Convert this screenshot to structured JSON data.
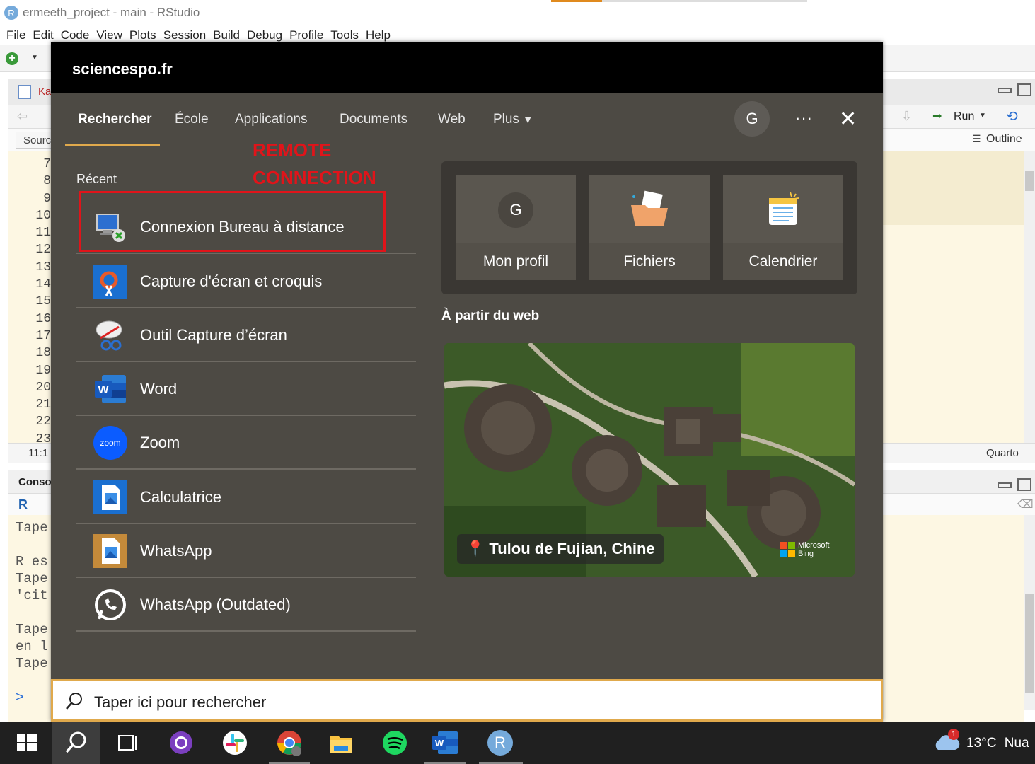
{
  "rstudio": {
    "title": "ermeeth_project - main - RStudio",
    "menu": [
      "File",
      "Edit",
      "Code",
      "View",
      "Plots",
      "Session",
      "Build",
      "Debug",
      "Profile",
      "Tools",
      "Help"
    ],
    "editor_tab": "Ka",
    "source_tab": "Sourc",
    "run_label": "Run",
    "outline_label": "Outline",
    "line_numbers": [
      "7",
      "8",
      "9",
      "10",
      "11",
      "12",
      "13",
      "14",
      "15",
      "16",
      "17",
      "18",
      "19",
      "20",
      "21",
      "22",
      "23"
    ],
    "status_position": "11:1",
    "status_lang": "Quarto",
    "console_tab": "Conso",
    "console_lines": [
      "Tape",
      "",
      "R es",
      "Tape",
      "'cit",
      "",
      "Tape",
      "en l",
      "Tape"
    ],
    "prompt": ">"
  },
  "start_menu": {
    "org": "sciencespo.fr",
    "tabs": [
      "Rechercher",
      "École",
      "Applications",
      "Documents",
      "Web",
      "Plus"
    ],
    "avatar_letter": "G",
    "annotation": [
      "REMOTE",
      "CONNECTION"
    ],
    "recent_label": "Récent",
    "recent_apps": [
      {
        "label": "Connexion Bureau à distance",
        "icon": "remote-desktop-icon"
      },
      {
        "label": "Capture d'écran et croquis",
        "icon": "snip-sketch-icon"
      },
      {
        "label": "Outil Capture d’écran",
        "icon": "snipping-tool-icon"
      },
      {
        "label": "Word",
        "icon": "word-icon"
      },
      {
        "label": "Zoom",
        "icon": "zoom-icon"
      },
      {
        "label": "Calculatrice",
        "icon": "calculator-icon"
      },
      {
        "label": "WhatsApp",
        "icon": "whatsapp-icon"
      },
      {
        "label": "WhatsApp (Outdated)",
        "icon": "whatsapp-outdated-icon"
      }
    ],
    "quick_links": [
      {
        "label": "Mon profil",
        "icon": "profile-icon"
      },
      {
        "label": "Fichiers",
        "icon": "files-icon"
      },
      {
        "label": "Calendrier",
        "icon": "calendar-icon"
      }
    ],
    "profile_letter": "G",
    "web_label": "À partir du web",
    "web_caption": "Tulou de Fujian, Chine",
    "bing_text": [
      "Microsoft",
      "Bing"
    ],
    "zoom_text": "zoom",
    "search_placeholder": "Taper ici pour rechercher"
  },
  "taskbar": {
    "weather": "13°C",
    "weather_text": "Nua",
    "notification_count": "1",
    "r_letter": "R"
  },
  "colors": {
    "accent": "#e0a94c",
    "annotation_red": "#e0141a",
    "menu_bg": "#4d4a44",
    "taskbar_bg": "#202020"
  }
}
